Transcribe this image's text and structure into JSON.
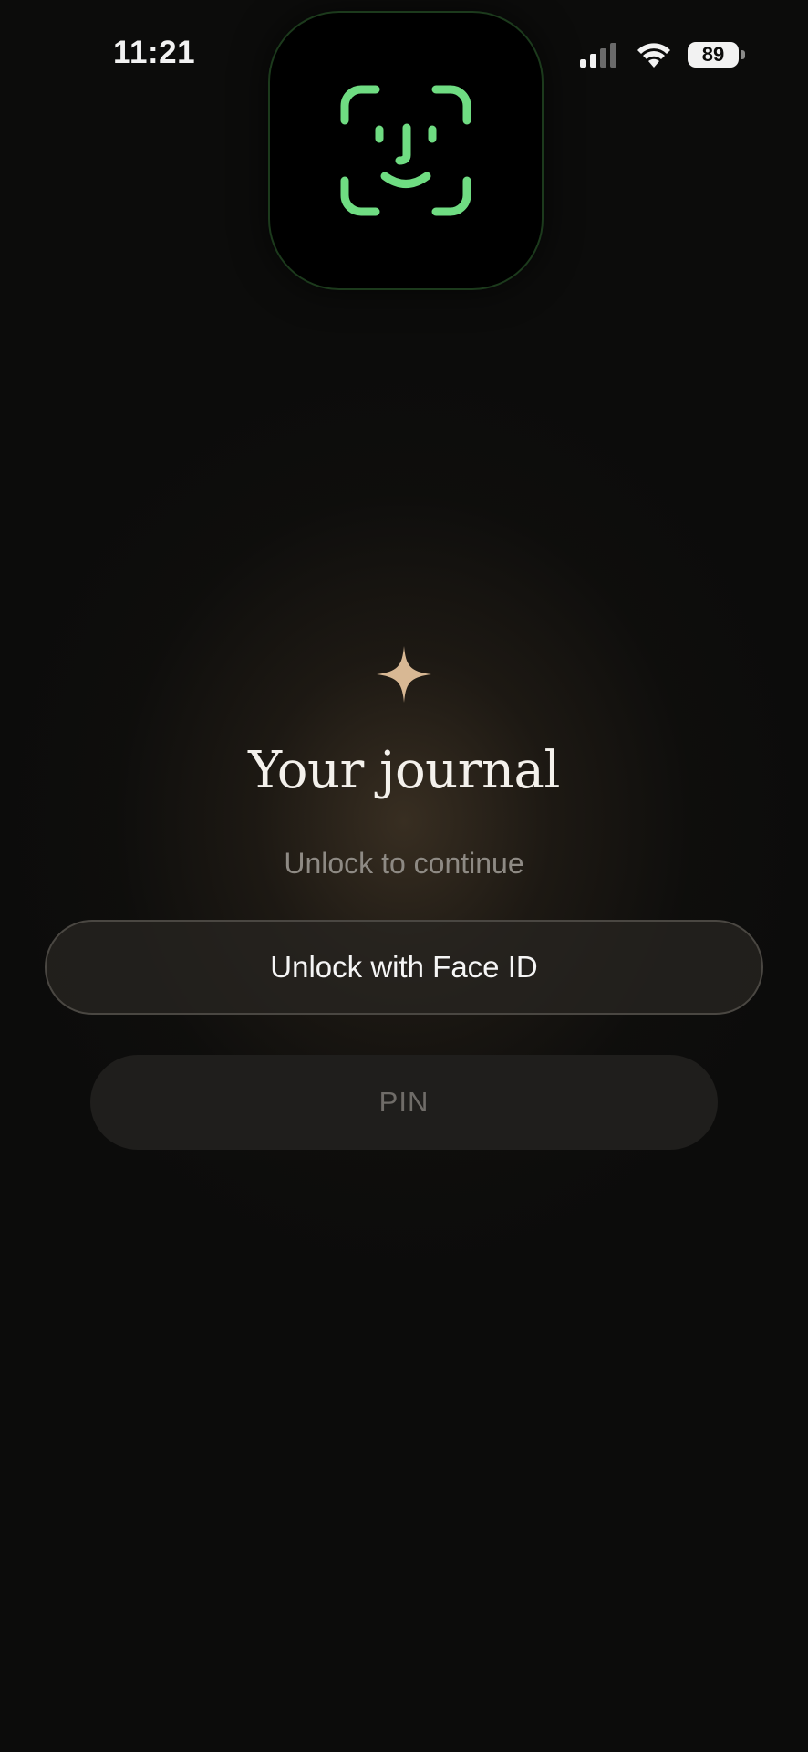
{
  "status_bar": {
    "time": "11:21",
    "battery_level": "89",
    "icons": [
      "signal-icon",
      "wifi-icon",
      "battery-icon"
    ]
  },
  "faceid_hud": {
    "icon": "face-id-icon",
    "color": "#6fdc82"
  },
  "lock": {
    "icon": "sparkle-icon",
    "accent_color": "#d8b894",
    "title": "Your journal",
    "subtitle": "Unlock to continue",
    "primary_button": "Unlock with Face ID",
    "secondary_button": "PIN"
  }
}
